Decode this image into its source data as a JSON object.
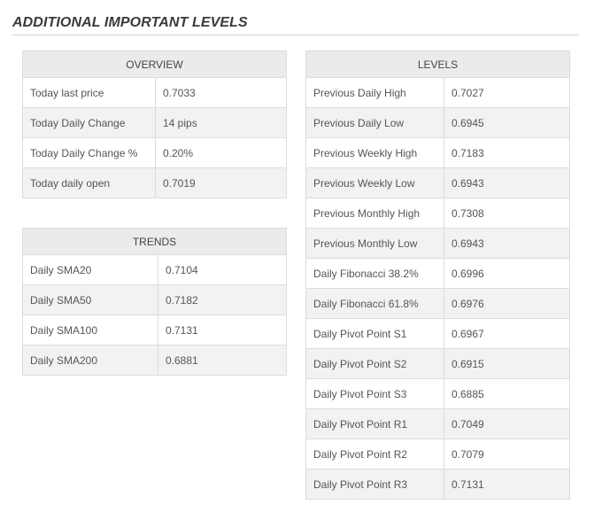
{
  "section_title": "ADDITIONAL IMPORTANT LEVELS",
  "overview": {
    "header": "OVERVIEW",
    "rows": [
      {
        "label": "Today last price",
        "value": "0.7033"
      },
      {
        "label": "Today Daily Change",
        "value": "14 pips"
      },
      {
        "label": "Today Daily Change %",
        "value": "0.20%"
      },
      {
        "label": "Today daily open",
        "value": "0.7019"
      }
    ]
  },
  "trends": {
    "header": "TRENDS",
    "rows": [
      {
        "label": "Daily SMA20",
        "value": "0.7104"
      },
      {
        "label": "Daily SMA50",
        "value": "0.7182"
      },
      {
        "label": "Daily SMA100",
        "value": "0.7131"
      },
      {
        "label": "Daily SMA200",
        "value": "0.6881"
      }
    ]
  },
  "levels": {
    "header": "LEVELS",
    "rows": [
      {
        "label": "Previous Daily High",
        "value": "0.7027"
      },
      {
        "label": "Previous Daily Low",
        "value": "0.6945"
      },
      {
        "label": "Previous Weekly High",
        "value": "0.7183"
      },
      {
        "label": "Previous Weekly Low",
        "value": "0.6943"
      },
      {
        "label": "Previous Monthly High",
        "value": "0.7308"
      },
      {
        "label": "Previous Monthly Low",
        "value": "0.6943"
      },
      {
        "label": "Daily Fibonacci 38.2%",
        "value": "0.6996"
      },
      {
        "label": "Daily Fibonacci 61.8%",
        "value": "0.6976"
      },
      {
        "label": "Daily Pivot Point S1",
        "value": "0.6967"
      },
      {
        "label": "Daily Pivot Point S2",
        "value": "0.6915"
      },
      {
        "label": "Daily Pivot Point S3",
        "value": "0.6885"
      },
      {
        "label": "Daily Pivot Point R1",
        "value": "0.7049"
      },
      {
        "label": "Daily Pivot Point R2",
        "value": "0.7079"
      },
      {
        "label": "Daily Pivot Point R3",
        "value": "0.7131"
      }
    ]
  }
}
